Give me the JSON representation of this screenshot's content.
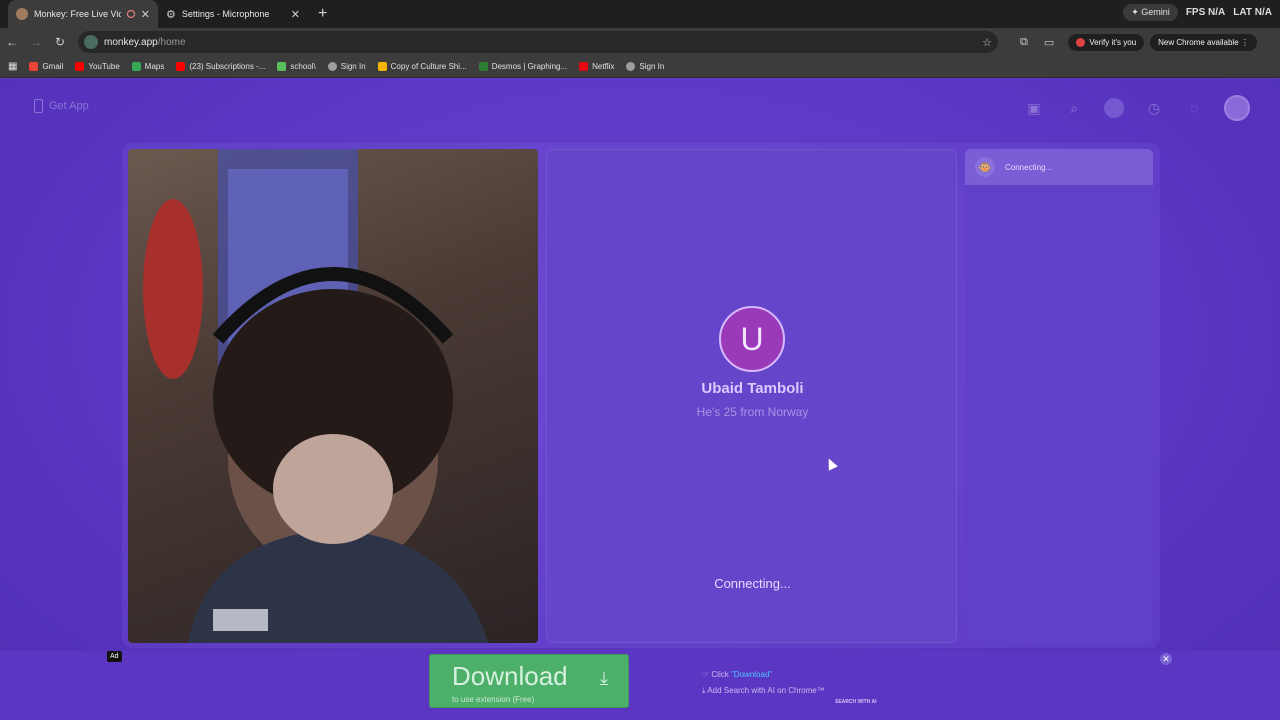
{
  "browser": {
    "tabs": [
      {
        "title": "Monkey: Free Live Video Ch",
        "active": true
      },
      {
        "title": "Settings - Microphone",
        "active": false
      }
    ],
    "gemini_label": "✦ Gemini",
    "fps_label": "FPS",
    "fps_value": "N/A",
    "lat_label": "LAT",
    "lat_value": "N/A",
    "url_host": "monkey.app",
    "url_path": "/home",
    "verify_label": "Verify it's you",
    "new_chrome_label": "New Chrome available",
    "bookmarks": [
      {
        "label": "Gmail",
        "color": "#ea4335"
      },
      {
        "label": "YouTube",
        "color": "#ff0000"
      },
      {
        "label": "Maps",
        "color": "#34a853"
      },
      {
        "label": "(23) Subscriptions -...",
        "color": "#ff0000"
      },
      {
        "label": "school\\",
        "color": "#5bbf5b"
      },
      {
        "label": "Sign In",
        "color": "#9e9e9e"
      },
      {
        "label": "Copy of Culture Shi...",
        "color": "#f4b400"
      },
      {
        "label": "Desmos | Graphing...",
        "color": "#2e7d32"
      },
      {
        "label": "Netflix",
        "color": "#e50914"
      },
      {
        "label": "Sign In",
        "color": "#9e9e9e"
      }
    ]
  },
  "page": {
    "get_app_label": "Get App",
    "stranger": {
      "initial": "U",
      "name": "Ubaid Tamboli",
      "subtitle": "He's 25 from Norway",
      "status": "Connecting..."
    },
    "chat": {
      "status": "Connecting..."
    }
  },
  "ad": {
    "tag": "Ad",
    "download_label": "Download",
    "download_sub": "to use extension (Free)",
    "line1_prefix": "Click ",
    "line1_highlight": "\"Download\"",
    "line2": "Add Search with AI on Chrome™",
    "brand": "SEARCH WITH AI"
  }
}
